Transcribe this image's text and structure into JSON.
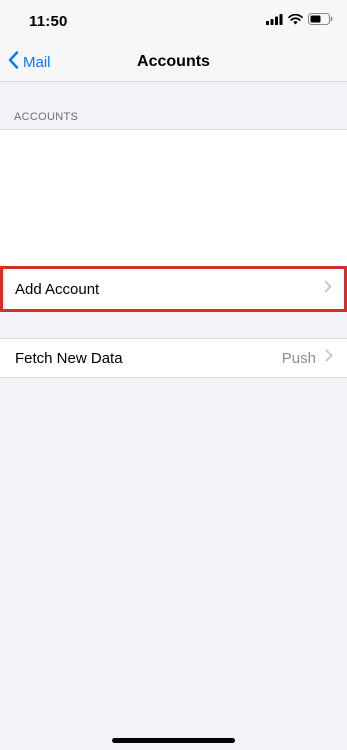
{
  "status_bar": {
    "time": "11:50"
  },
  "nav": {
    "back_label": "Mail",
    "title": "Accounts"
  },
  "section": {
    "header": "ACCOUNTS"
  },
  "rows": {
    "add_account": {
      "label": "Add Account"
    },
    "fetch_new_data": {
      "label": "Fetch New Data",
      "value": "Push"
    }
  },
  "colors": {
    "accent": "#007aff",
    "highlight_border": "#d32f2f",
    "background": "#f2f2f7",
    "secondary_text": "#8e8e93"
  },
  "icons": [
    "signal-icon",
    "wifi-icon",
    "battery-icon",
    "chevron-left-icon",
    "chevron-right-icon"
  ]
}
